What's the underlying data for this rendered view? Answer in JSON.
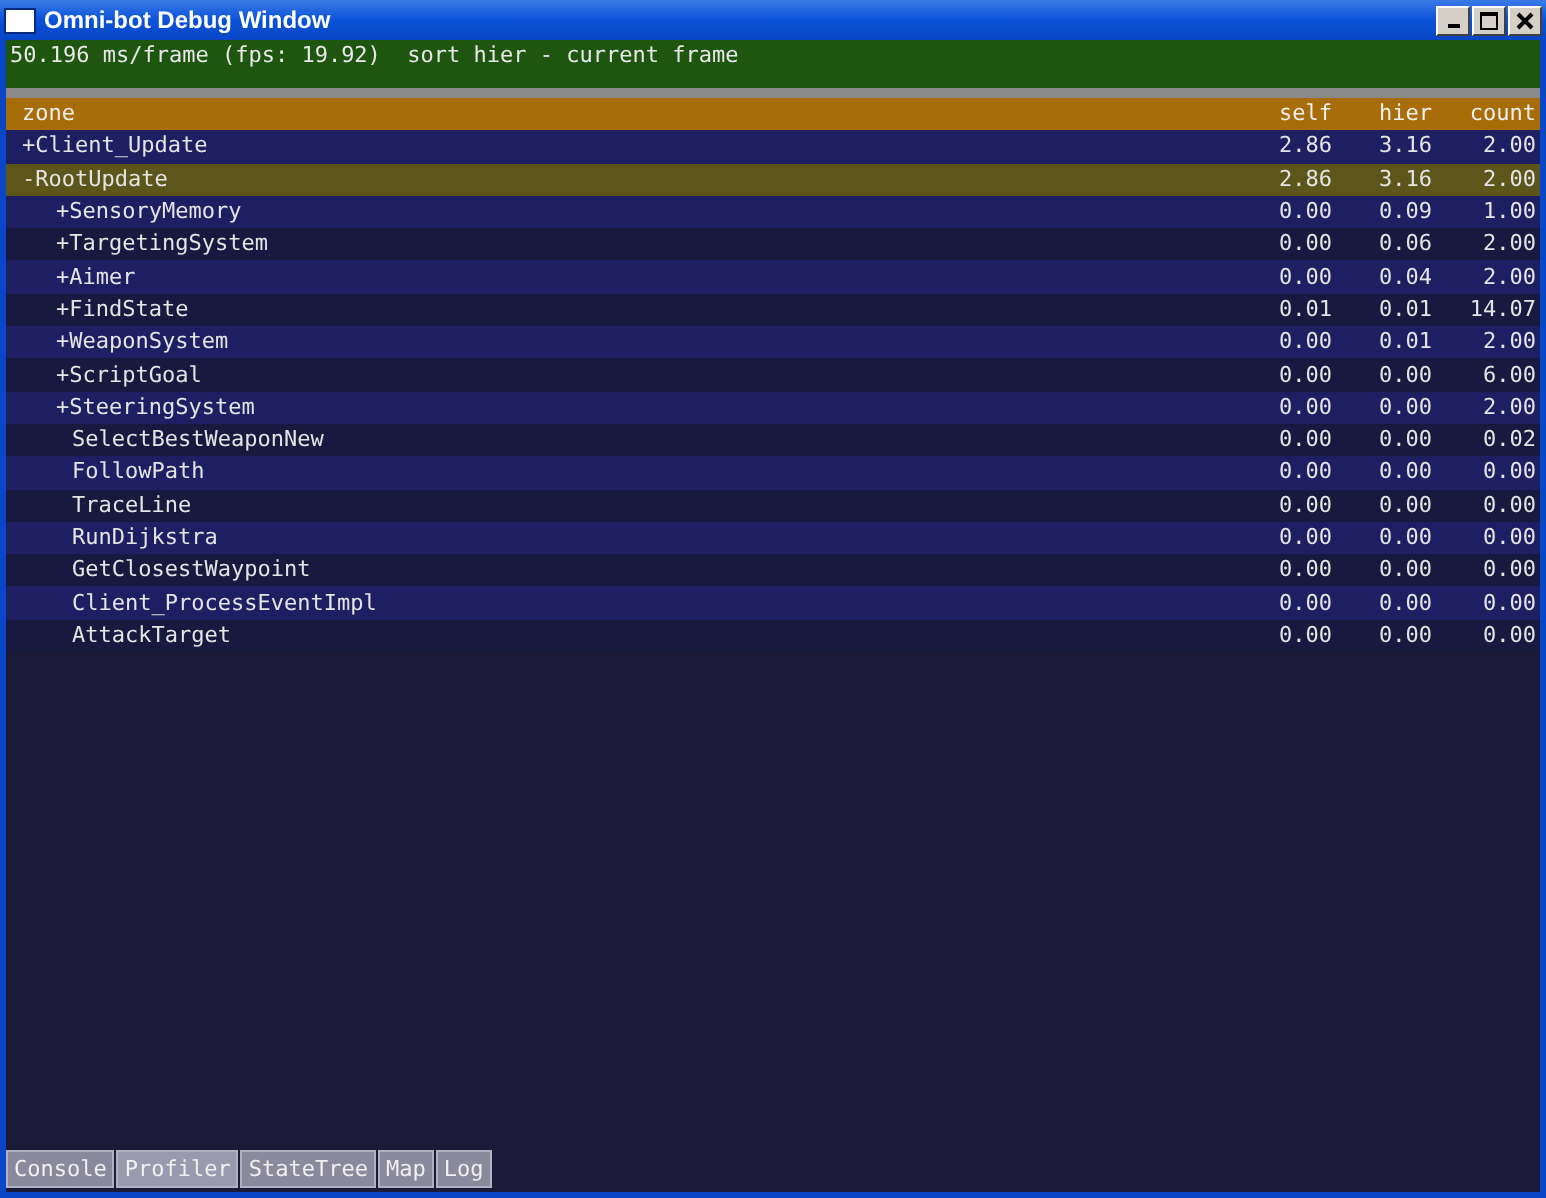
{
  "window": {
    "title": "Omni-bot Debug Window"
  },
  "status_line": "50.196 ms/frame (fps: 19.92)  sort hier - current frame",
  "table": {
    "columns": [
      "zone",
      "self",
      "hier",
      "count"
    ],
    "rows": [
      {
        "label": "+Client_Update",
        "self": "2.86",
        "hier": "3.16",
        "count": "2.00",
        "selected": false
      },
      {
        "label": "-RootUpdate",
        "self": "2.86",
        "hier": "3.16",
        "count": "2.00",
        "selected": true,
        "children": [
          {
            "label": "+SensoryMemory",
            "self": "0.00",
            "hier": "0.09",
            "count": "1.00",
            "selected": false
          },
          {
            "label": "+TargetingSystem",
            "self": "0.00",
            "hier": "0.06",
            "count": "2.00",
            "selected": false
          },
          {
            "label": "+Aimer",
            "self": "0.00",
            "hier": "0.04",
            "count": "2.00",
            "selected": false
          },
          {
            "label": "+FindState",
            "self": "0.01",
            "hier": "0.01",
            "count": "14.07",
            "selected": false
          },
          {
            "label": "+WeaponSystem",
            "self": "0.00",
            "hier": "0.01",
            "count": "2.00",
            "selected": false
          },
          {
            "label": "+ScriptGoal",
            "self": "0.00",
            "hier": "0.00",
            "count": "6.00",
            "selected": false
          },
          {
            "label": "+SteeringSystem",
            "self": "0.00",
            "hier": "0.00",
            "count": "2.00",
            "selected": false
          },
          {
            "label": "SelectBestWeaponNew",
            "self": "0.00",
            "hier": "0.00",
            "count": "0.02",
            "selected": false
          },
          {
            "label": "FollowPath",
            "self": "0.00",
            "hier": "0.00",
            "count": "0.00",
            "selected": false
          },
          {
            "label": "TraceLine",
            "self": "0.00",
            "hier": "0.00",
            "count": "0.00",
            "selected": false
          },
          {
            "label": "RunDijkstra",
            "self": "0.00",
            "hier": "0.00",
            "count": "0.00",
            "selected": false
          },
          {
            "label": "GetClosestWaypoint",
            "self": "0.00",
            "hier": "0.00",
            "count": "0.00",
            "selected": false
          },
          {
            "label": "Client_ProcessEventImpl",
            "self": "0.00",
            "hier": "0.00",
            "count": "0.00",
            "selected": false
          },
          {
            "label": "AttackTarget",
            "self": "0.00",
            "hier": "0.00",
            "count": "0.00",
            "selected": false
          }
        ]
      }
    ]
  },
  "tabs": [
    {
      "label": "Console",
      "selected": false
    },
    {
      "label": "Profiler",
      "selected": true
    },
    {
      "label": "StateTree",
      "selected": false
    },
    {
      "label": "Map",
      "selected": false
    },
    {
      "label": "Log",
      "selected": false
    }
  ]
}
